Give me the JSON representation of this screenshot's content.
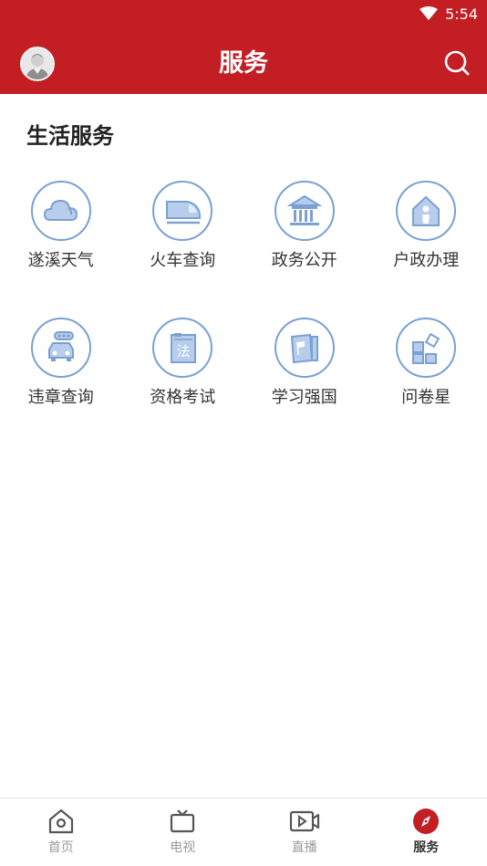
{
  "status_bar": {
    "time": "5:54"
  },
  "header": {
    "title": "服务",
    "brand_color": "#c31e24",
    "avatar_icon": "avatar-icon",
    "search_icon": "search-icon"
  },
  "section": {
    "title": "生活服务"
  },
  "services": [
    {
      "label": "遂溪天气",
      "icon": "cloud-icon"
    },
    {
      "label": "火车查询",
      "icon": "train-icon"
    },
    {
      "label": "政务公开",
      "icon": "government-building-icon"
    },
    {
      "label": "户政办理",
      "icon": "household-registration-icon"
    },
    {
      "label": "违章查询",
      "icon": "traffic-violation-icon"
    },
    {
      "label": "资格考试",
      "icon": "law-book-icon"
    },
    {
      "label": "学习强国",
      "icon": "study-flag-icon"
    },
    {
      "label": "问卷星",
      "icon": "questionnaire-icon"
    }
  ],
  "tabbar": {
    "items": [
      {
        "label": "首页",
        "icon": "home-icon",
        "active": false
      },
      {
        "label": "电视",
        "icon": "tv-icon",
        "active": false
      },
      {
        "label": "直播",
        "icon": "live-video-icon",
        "active": false
      },
      {
        "label": "服务",
        "icon": "compass-icon",
        "active": true
      }
    ],
    "active_color": "#c31e24"
  }
}
